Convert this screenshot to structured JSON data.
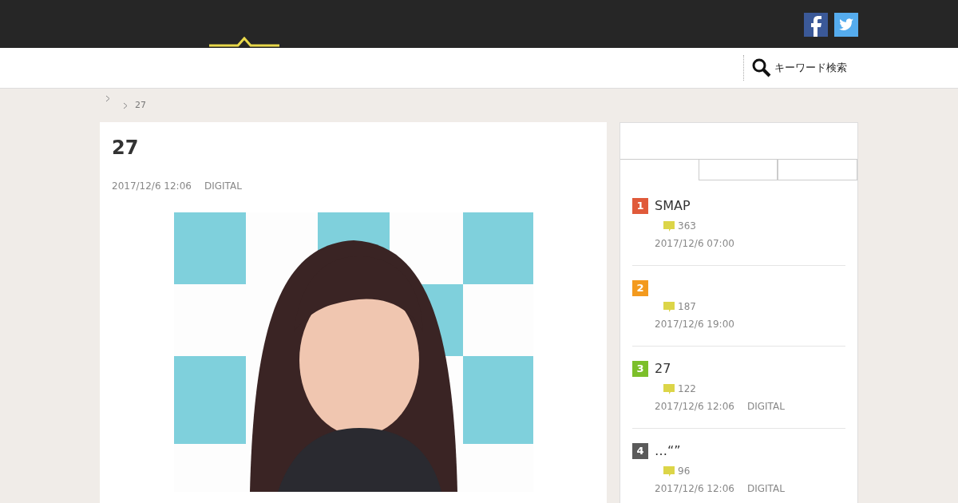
{
  "header": {
    "social": [
      {
        "kind": "facebook"
      },
      {
        "kind": "twitter"
      }
    ]
  },
  "search": {
    "label": "キーワード検索"
  },
  "breadcrumb": [
    {
      "kind": "home"
    },
    {
      "kind": "page",
      "label": "27"
    }
  ],
  "article": {
    "title": "27",
    "date": "2017/12/6 12:06",
    "category": "DIGITAL"
  },
  "ranking": {
    "tabs": [
      {
        "selected": true
      },
      {
        "selected": false
      },
      {
        "selected": false
      }
    ],
    "items": [
      {
        "rank": "1",
        "color": "#e05a3a",
        "title": "SMAP",
        "comments": "363",
        "date": "2017/12/6 07:00"
      },
      {
        "rank": "2",
        "color": "#f39a1e",
        "comments": "187",
        "date": "2017/12/6 19:00"
      },
      {
        "rank": "3",
        "color": "#7cbf2a",
        "title": "27",
        "comments": "122",
        "date": "2017/12/6 12:06",
        "category": "DIGITAL"
      },
      {
        "rank": "4",
        "color": "#5a5a5a",
        "title": "…“”",
        "comments": "96",
        "date": "2017/12/6 12:06",
        "category": "DIGITAL"
      }
    ]
  }
}
